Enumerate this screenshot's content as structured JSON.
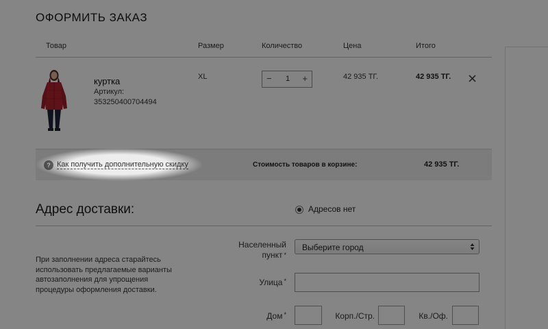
{
  "page_title": "ОФОРМИТЬ ЗАКАЗ",
  "table_headers": {
    "product": "Товар",
    "size": "Размер",
    "quantity": "Количество",
    "price": "Цена",
    "total": "Итого"
  },
  "cart_item": {
    "name": "куртка",
    "article_label": "Артикул:",
    "article": "353250400704494",
    "size": "XL",
    "quantity": "1",
    "minus": "−",
    "plus": "+",
    "price": "42 935 ТГ.",
    "total": "42 935 ТГ.",
    "image_icon": "jacket-product-photo",
    "remove_icon": "close-icon"
  },
  "summary": {
    "help_glyph": "?",
    "discount_link": "Как получить дополнительную скидку",
    "cart_total_label": "Стоимость товаров в корзине:",
    "cart_total_value": "42 935 ТГ."
  },
  "delivery": {
    "title": "Адрес доставки:",
    "radio_label": "Адресов нет",
    "hint": "При заполнении адреса старайтесь использовать предлагаемые варианты автозаполнения для упрощения процедуры оформления доставки.",
    "city_label_1": "Населенный",
    "city_label_2": "пункт",
    "city_placeholder": "Выберите город",
    "street_label": "Улица",
    "house_label": "Дом",
    "building_label": "Корп./Стр.",
    "apartment_label": "Кв./Оф.",
    "required_mark": "*"
  },
  "colors": {
    "overlay": "#000000",
    "summary_bar": "#ededed",
    "jacket": "#b3232f"
  }
}
